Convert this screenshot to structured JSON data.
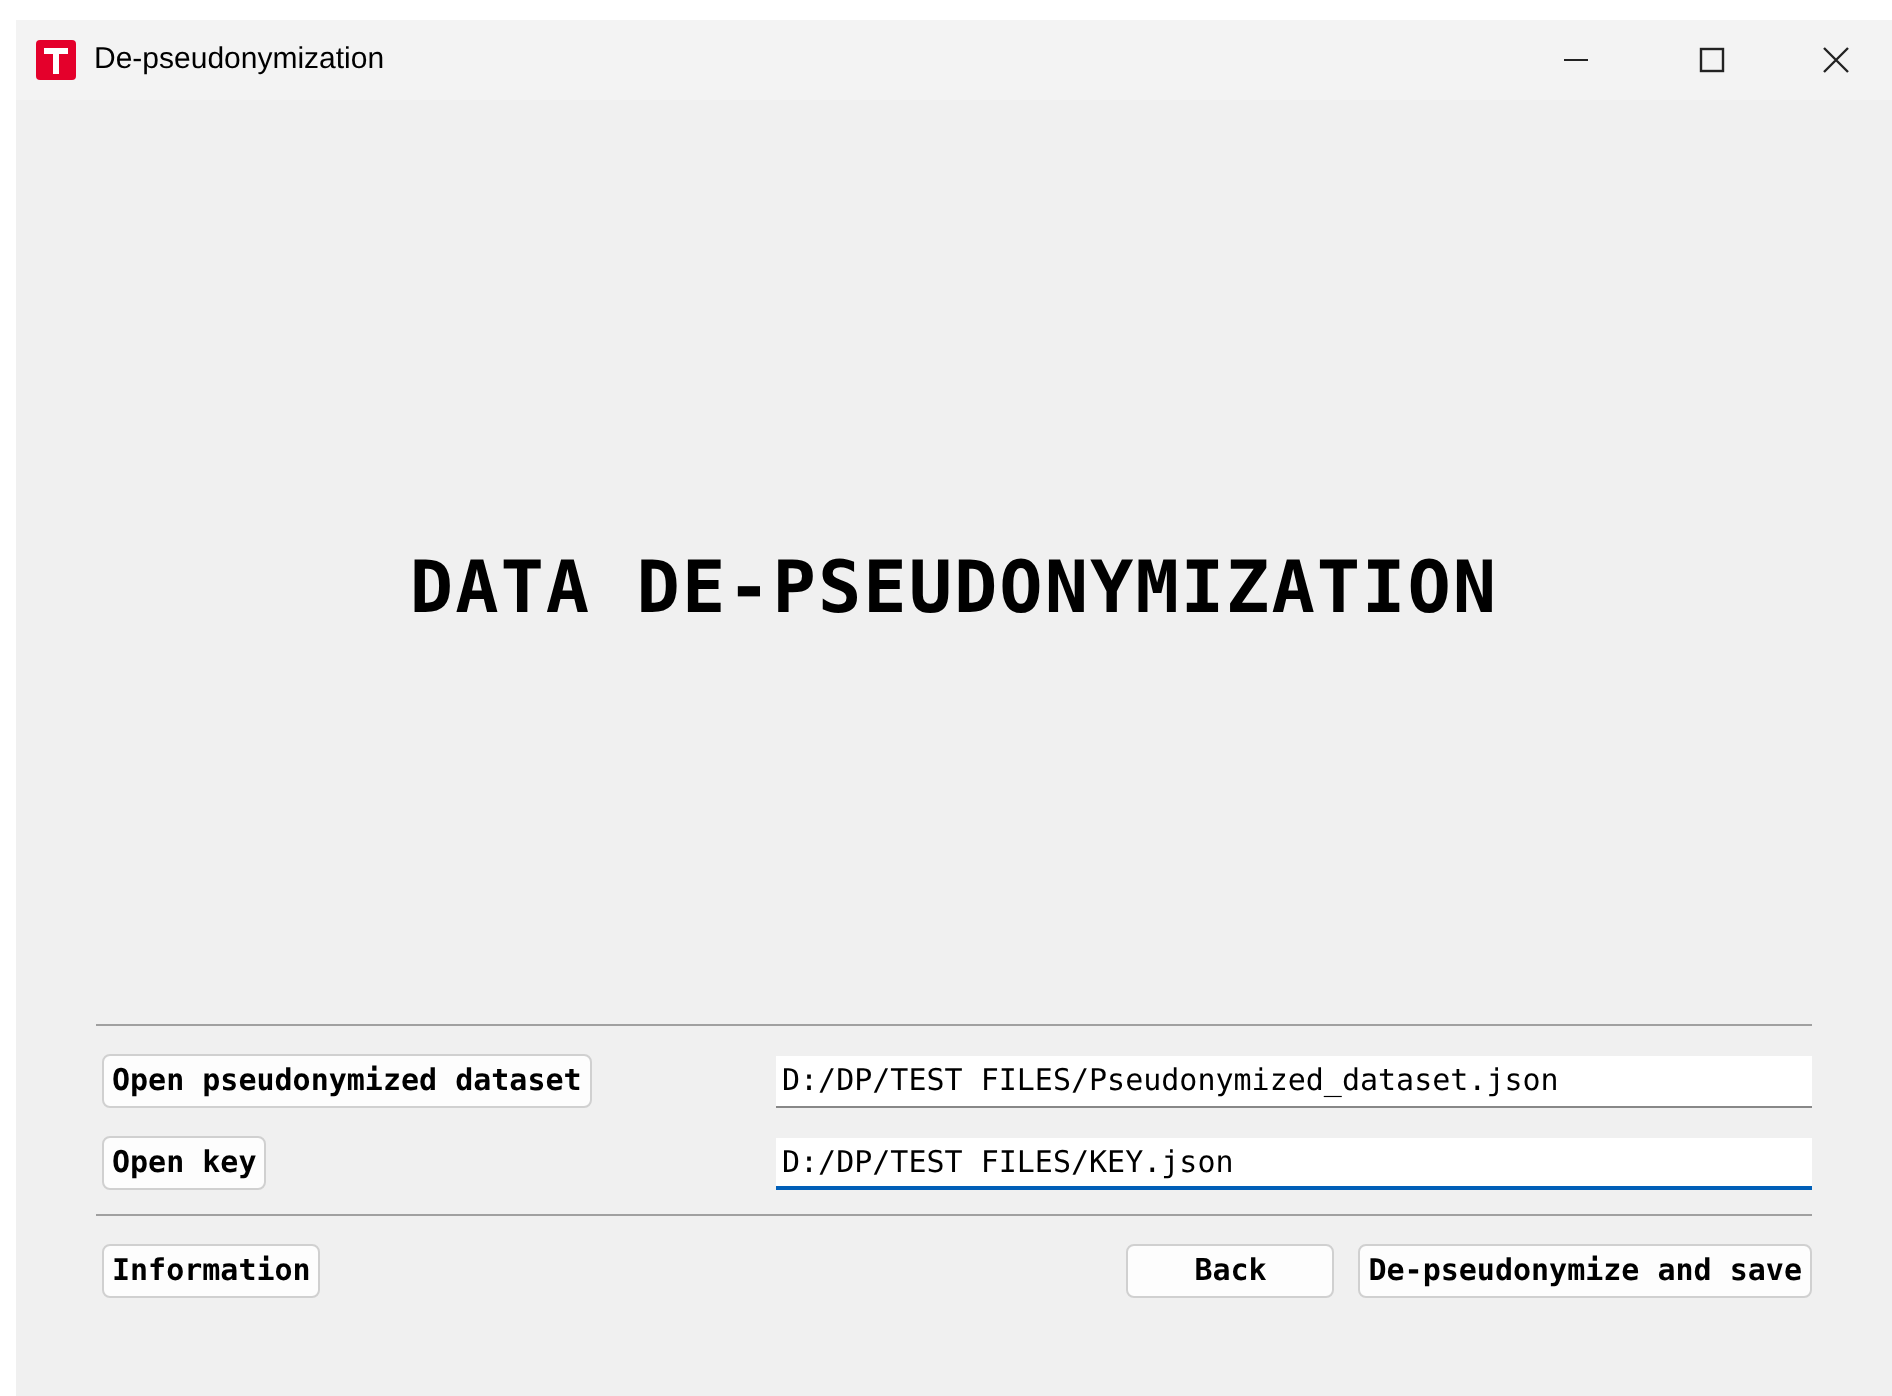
{
  "window": {
    "title": "De-pseudonymization"
  },
  "heading": "DATA DE-PSEUDONYMIZATION",
  "file_rows": [
    {
      "button": "Open pseudonymized dataset",
      "value": "D:/DP/TEST FILES/Pseudonymized_dataset.json",
      "focused": false
    },
    {
      "button": "Open key",
      "value": "D:/DP/TEST FILES/KEY.json",
      "focused": true
    }
  ],
  "buttons": {
    "info": "Information",
    "back": "Back",
    "run": "De-pseudonymize and save"
  }
}
